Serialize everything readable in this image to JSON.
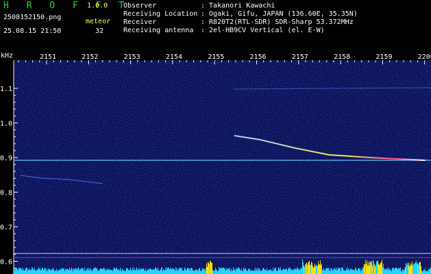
{
  "app": {
    "logo": "H R O F F T",
    "version": "1.0.0"
  },
  "file": {
    "name": "2508152150.png",
    "datetime": "25.08.15 21:50"
  },
  "meteor": {
    "label": "meteor",
    "count": "32"
  },
  "info": [
    {
      "key": "Observer",
      "value": ": Takanori Kawachi"
    },
    {
      "key": "Receiving Location",
      "value": ": Ogaki, Gifu, JAPAN (136.60E, 35.35N)"
    },
    {
      "key": "Receiver",
      "value": ": R820T2(RTL-SDR) SDR-Sharp 53.372MHz"
    },
    {
      "key": "Receiving antenna",
      "value": ": 2el-HB9CV Vertical (el. E-W)"
    }
  ],
  "spectrogram": {
    "unit": "kHz",
    "time_labels": [
      "2151",
      "2152",
      "2153",
      "2154",
      "2155",
      "2156",
      "2157",
      "2158",
      "2159",
      "2200"
    ],
    "freq_labels": [
      "1.1",
      "1.0",
      "0.9",
      "0.8",
      "0.7",
      "0.6"
    ],
    "colors": {
      "background": "#000040",
      "signal": "#9ad6ff",
      "trace_hot": "#ff4fa0",
      "bars": "#27d3ff",
      "bars_hot": "#ffe000"
    }
  }
}
